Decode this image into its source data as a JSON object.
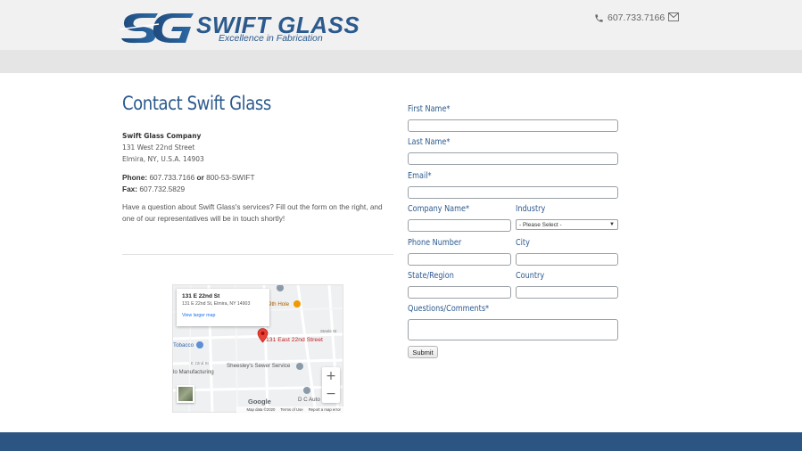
{
  "header": {
    "brand_name": "SWIFT GLASS",
    "tagline": "Excellence in Fabrication",
    "logo_mark": "SG",
    "phone": "607.733.7166",
    "icons": {
      "phone": "phone-icon",
      "mail": "mail-icon"
    }
  },
  "colors": {
    "brand_blue": "#2c5a8e",
    "footer_blue": "#2c5583",
    "header_bg": "#f1f1f1",
    "nav_band": "#e5e5e5"
  },
  "contact": {
    "title": "Contact Swift Glass",
    "company": "Swift Glass Company",
    "street": "131 West 22nd Street",
    "city_line": "Elmira, NY, U.S.A. 14903",
    "phone_label": "Phone:",
    "phone": "607.733.7166",
    "or": "or",
    "alt_phone": "800-53-SWIFT",
    "fax_label": "Fax:",
    "fax": "607.732.5829",
    "intro": "Have a question about Swift Glass's services? Fill out the form on the right, and one of our representatives will be in touch shortly!"
  },
  "map": {
    "card_title": "131 E 22nd St",
    "card_address": "131 E 22nd St, Elmira, NY 14903",
    "card_link": "View larger map",
    "pin_label": "131 East 22nd Street",
    "places": [
      "9th Hole",
      "Tobacco",
      "Sheesley's Sewer Service",
      "D C Auto",
      "lo Manufacturing"
    ],
    "streets": [
      "E 22nd St",
      "Steele St"
    ],
    "zoom_in": "+",
    "zoom_out": "−",
    "google": "Google",
    "footer": [
      "Map data ©2020",
      "Terms of Use",
      "Report a map error"
    ]
  },
  "form": {
    "first_name": "First Name*",
    "last_name": "Last Name*",
    "email": "Email*",
    "company": "Company Name*",
    "industry": "Industry",
    "industry_selected": "- Please Select -",
    "phone": "Phone Number",
    "city": "City",
    "state": "State/Region",
    "country": "Country",
    "comments": "Questions/Comments*",
    "submit": "Submit"
  }
}
